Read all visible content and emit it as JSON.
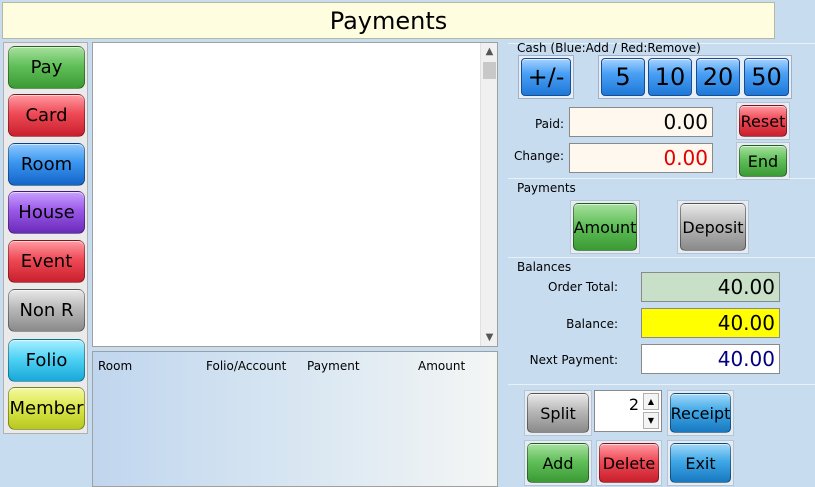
{
  "title": "Payments",
  "nav": {
    "items": [
      {
        "label": "Pay",
        "color": "#5cb85c"
      },
      {
        "label": "Card",
        "color": "#ef4a56"
      },
      {
        "label": "Room",
        "color": "#3a96f0"
      },
      {
        "label": "House",
        "color": "#9a58e8"
      },
      {
        "label": "Event",
        "color": "#ef4a56"
      },
      {
        "label": "Non R",
        "color": "#b8b8b8"
      },
      {
        "label": "Folio",
        "color": "#50d2f4"
      },
      {
        "label": "Member",
        "color": "#dce84c"
      }
    ]
  },
  "table": {
    "columns": [
      "Room",
      "Folio/Account",
      "Payment",
      "Amount"
    ],
    "rows": []
  },
  "cash": {
    "label": "Cash (Blue:Add / Red:Remove)",
    "toggle": "+/-",
    "denominations": [
      "5",
      "10",
      "20",
      "50"
    ],
    "paid_label": "Paid:",
    "paid_value": "0.00",
    "change_label": "Change:",
    "change_value": "0.00",
    "reset_label": "Reset",
    "end_label": "End"
  },
  "payments": {
    "label": "Payments",
    "amount_label": "Amount",
    "deposit_label": "Deposit"
  },
  "balances": {
    "label": "Balances",
    "order_total_label": "Order Total:",
    "order_total_value": "40.00",
    "balance_label": "Balance:",
    "balance_value": "40.00",
    "next_payment_label": "Next Payment:",
    "next_payment_value": "40.00"
  },
  "actions": {
    "split_label": "Split",
    "split_count": "2",
    "receipt_label": "Receipt",
    "add_label": "Add",
    "delete_label": "Delete",
    "exit_label": "Exit"
  },
  "colors": {
    "balance_highlight": "#ffff00",
    "order_total_bg": "#c8e0c8",
    "change_text": "#e00000",
    "next_payment_text": "#000080"
  }
}
